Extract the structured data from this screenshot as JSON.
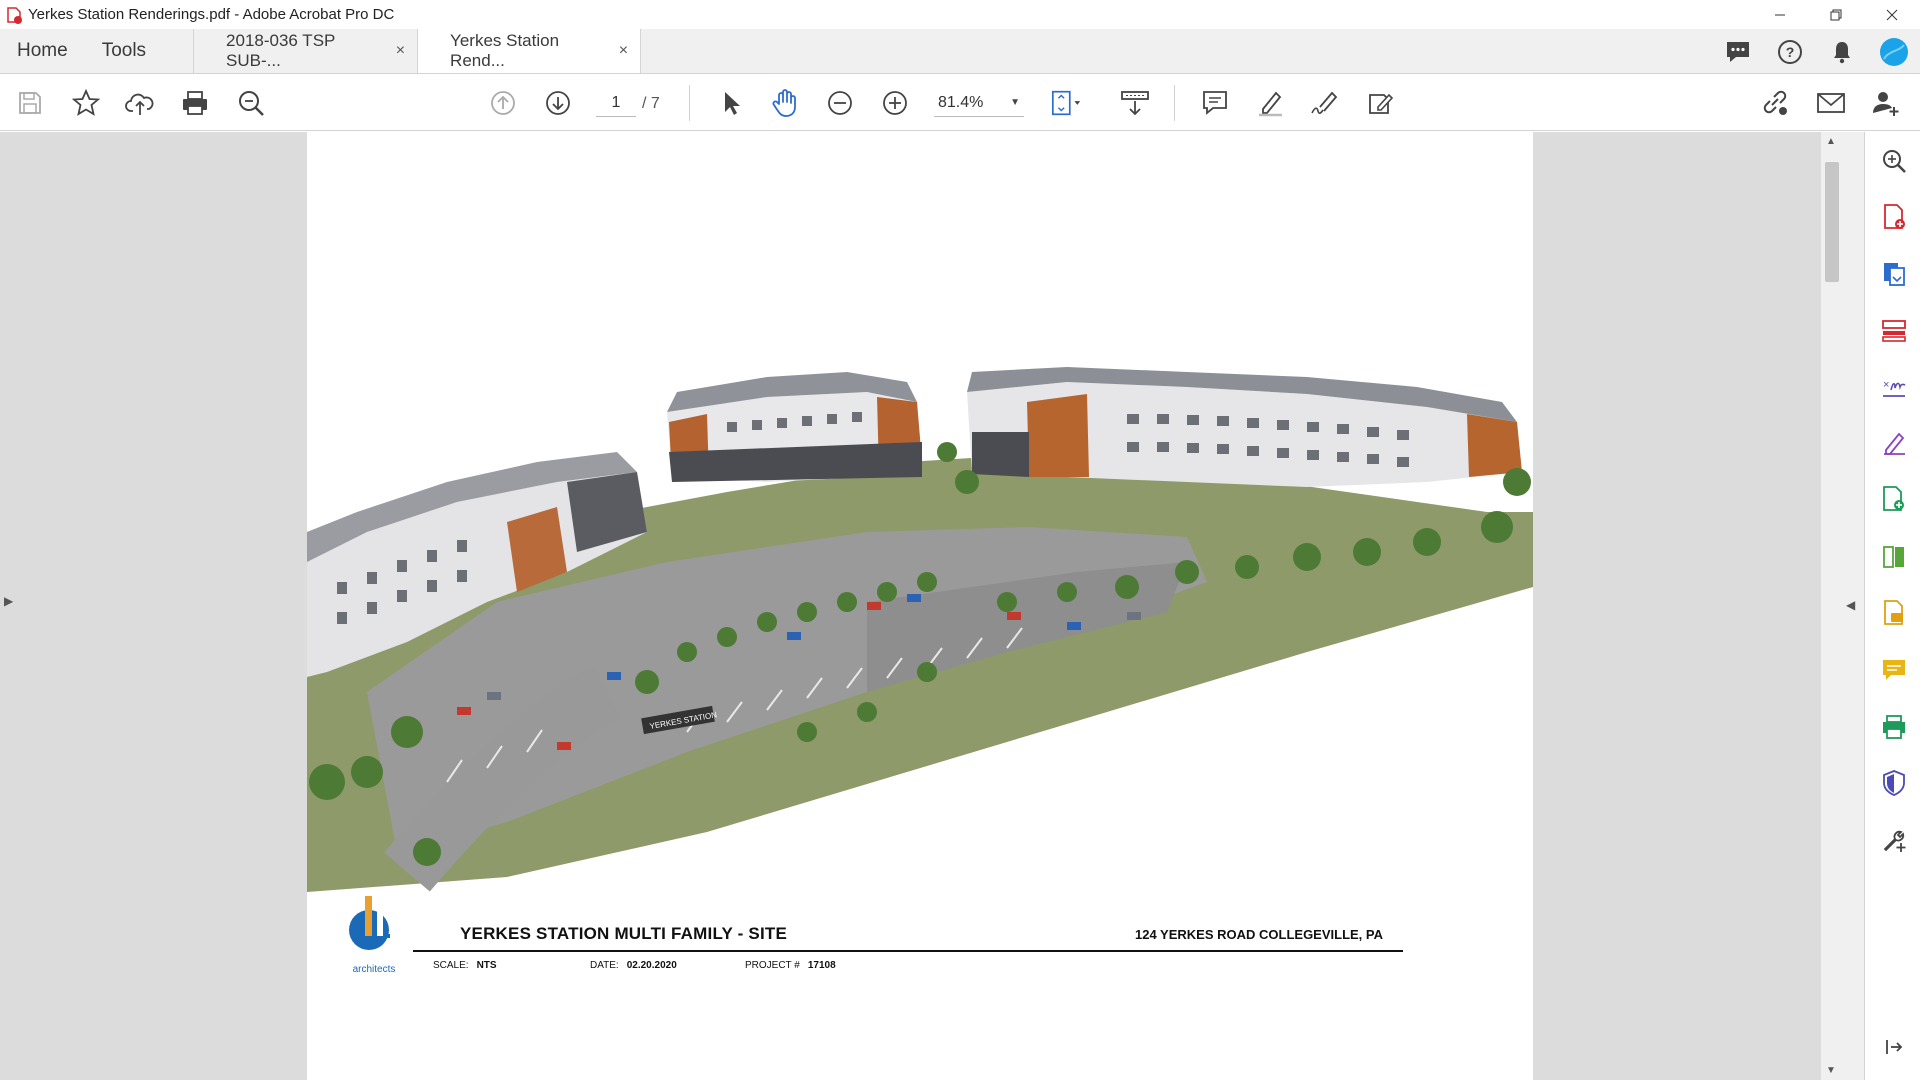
{
  "window": {
    "title": "Yerkes Station Renderings.pdf - Adobe Acrobat Pro DC"
  },
  "nav": {
    "home": "Home",
    "tools": "Tools"
  },
  "tabs": [
    {
      "label": "2018-036 TSP SUB-...",
      "close": "×"
    },
    {
      "label": "Yerkes Station Rend...",
      "close": "×"
    }
  ],
  "toolbar": {
    "page_current": "1",
    "page_total": "/ 7",
    "zoom": "81.4%"
  },
  "document": {
    "title": "YERKES STATION MULTI FAMILY - SITE",
    "address": "124 YERKES ROAD COLLEGEVILLE, PA",
    "scale_label": "SCALE:",
    "scale_value": "NTS",
    "date_label": "DATE:",
    "date_value": "02.20.2020",
    "project_label": "PROJECT #",
    "project_value": "17108",
    "logo_text": "architects",
    "monument_sign": "YERKES STATION"
  },
  "colors": {
    "acrobat_red": "#d7282f",
    "tool_blue": "#2d6ccf",
    "avatar": "#1aa3e8"
  }
}
